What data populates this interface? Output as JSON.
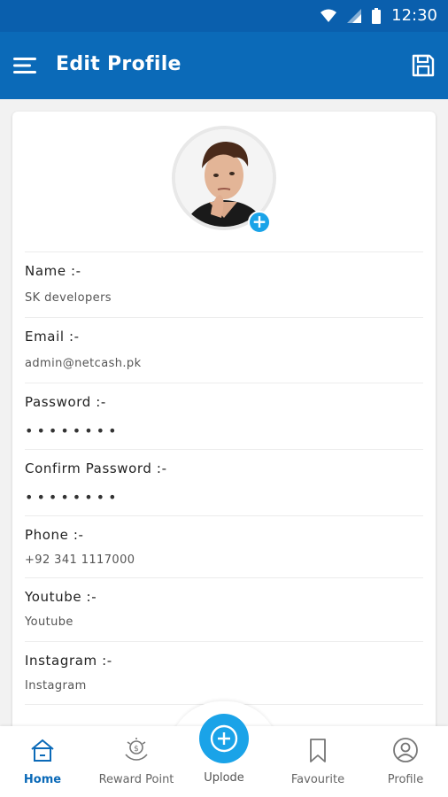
{
  "status_bar": {
    "time": "12:30"
  },
  "app_bar": {
    "title": "Edit Profile"
  },
  "fields": [
    {
      "label": "Name :-",
      "value": "SK developers"
    },
    {
      "label": "Email :-",
      "value": "admin@netcash.pk"
    },
    {
      "label": "Password :-",
      "value": "••••••••"
    },
    {
      "label": "Confirm Password :-",
      "value": "••••••••"
    },
    {
      "label": "Phone :-",
      "value": "+92 341 1117000"
    },
    {
      "label": "Youtube :-",
      "value": "Youtube"
    },
    {
      "label": "Instagram :-",
      "value": "Instagram"
    }
  ],
  "bottom_nav": {
    "home": "Home",
    "reward": "Reward Point",
    "upload": "Uplode",
    "favourite": "Favourite",
    "profile": "Profile"
  },
  "colors": {
    "primary": "#0b6ab8",
    "accent": "#1aa3e8"
  }
}
